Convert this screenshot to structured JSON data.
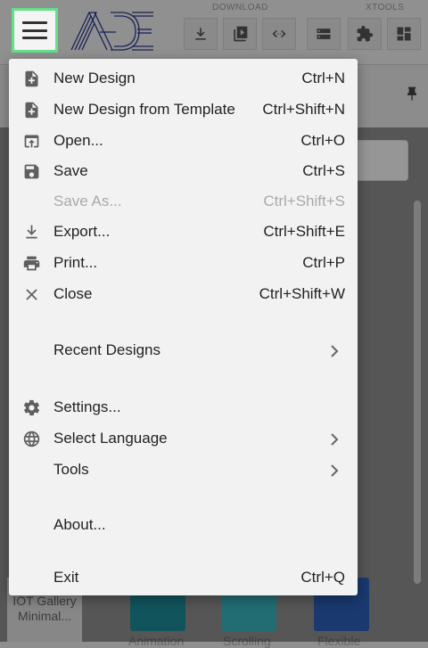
{
  "toolbar": {
    "group_download": "DOWNLOAD",
    "group_xtools": "XTOOLS"
  },
  "background": {
    "gallery_card": "IOT Gallery Minimal...",
    "tile_labels": [
      "Animation",
      "Scrolling",
      "Flexible"
    ]
  },
  "menu": {
    "items": [
      {
        "label": "New Design",
        "shortcut": "Ctrl+N",
        "icon": "new-file-icon"
      },
      {
        "label": "New Design from Template",
        "shortcut": "Ctrl+Shift+N",
        "icon": "new-template-icon"
      },
      {
        "label": "Open...",
        "shortcut": "Ctrl+O",
        "icon": "open-icon"
      },
      {
        "label": "Save",
        "shortcut": "Ctrl+S",
        "icon": "save-icon"
      },
      {
        "label": "Save As...",
        "shortcut": "Ctrl+Shift+S",
        "disabled": true
      },
      {
        "label": "Export...",
        "shortcut": "Ctrl+Shift+E",
        "icon": "download-icon"
      },
      {
        "label": "Print...",
        "shortcut": "Ctrl+P",
        "icon": "print-icon"
      },
      {
        "label": "Close",
        "shortcut": "Ctrl+Shift+W",
        "icon": "close-icon"
      },
      {
        "label": "Recent Designs",
        "submenu": true
      },
      {
        "label": "Settings...",
        "icon": "gear-icon"
      },
      {
        "label": "Select Language",
        "submenu": true,
        "icon": "globe-icon"
      },
      {
        "label": "Tools",
        "submenu": true
      },
      {
        "label": "About..."
      },
      {
        "label": "Exit",
        "shortcut": "Ctrl+Q"
      }
    ]
  },
  "colors": {
    "menu_bg": "#f2f2f2",
    "hamburger_border": "#62e08a",
    "logo_blue": "#2b3a8f",
    "disabled_text": "#a9a9a9"
  }
}
